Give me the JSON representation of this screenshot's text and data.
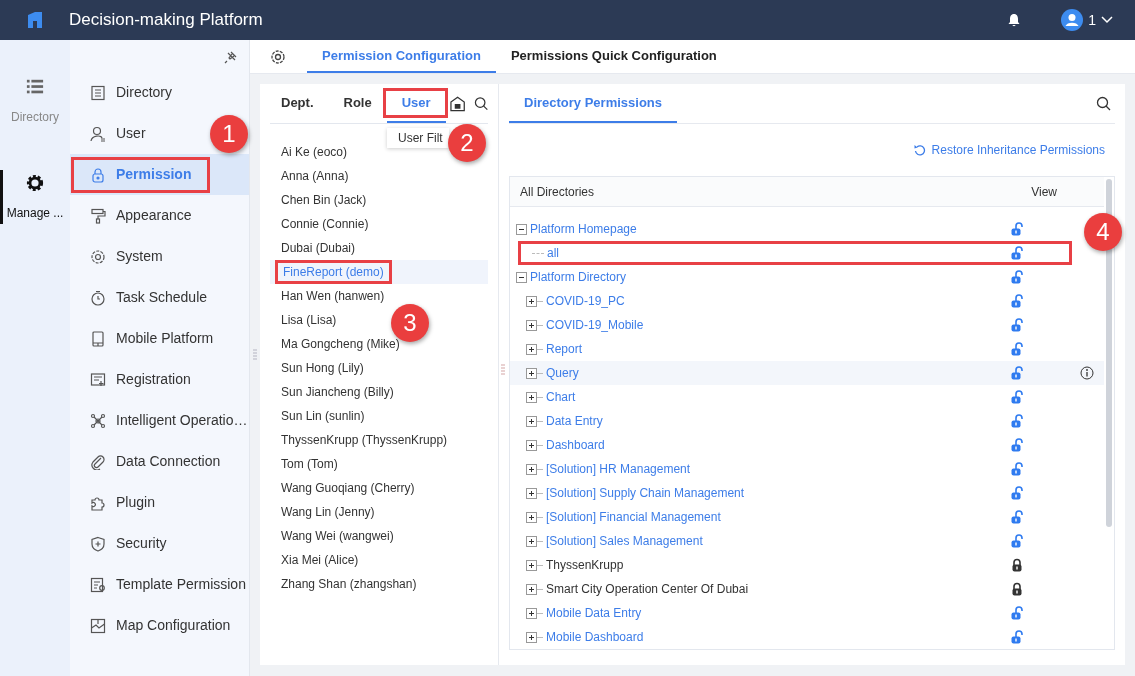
{
  "header": {
    "title": "Decision-making Platform",
    "user": "1"
  },
  "rail": [
    {
      "label": "Directory",
      "kind": "list",
      "selected": false
    },
    {
      "label": "Manage ...",
      "kind": "gear",
      "selected": true
    }
  ],
  "menu": [
    {
      "label": "Directory",
      "kind": "directory",
      "selected": false,
      "highlighted": false
    },
    {
      "label": "User",
      "kind": "user",
      "selected": false,
      "highlighted": false
    },
    {
      "label": "Permission",
      "kind": "lock",
      "selected": true,
      "highlighted": true
    },
    {
      "label": "Appearance",
      "kind": "roller",
      "selected": false,
      "highlighted": false
    },
    {
      "label": "System",
      "kind": "gear",
      "selected": false,
      "highlighted": false
    },
    {
      "label": "Task Schedule",
      "kind": "timer",
      "selected": false,
      "highlighted": false
    },
    {
      "label": "Mobile Platform",
      "kind": "phone",
      "selected": false,
      "highlighted": false
    },
    {
      "label": "Registration",
      "kind": "form",
      "selected": false,
      "highlighted": false
    },
    {
      "label": "Intelligent Operatio…",
      "kind": "network",
      "selected": false,
      "highlighted": false
    },
    {
      "label": "Data Connection",
      "kind": "clip",
      "selected": false,
      "highlighted": false
    },
    {
      "label": "Plugin",
      "kind": "puzzle",
      "selected": false,
      "highlighted": false
    },
    {
      "label": "Security",
      "kind": "shield",
      "selected": false,
      "highlighted": false
    },
    {
      "label": "Template Permission",
      "kind": "doc",
      "selected": false,
      "highlighted": false
    },
    {
      "label": "Map Configuration",
      "kind": "map",
      "selected": false,
      "highlighted": false
    }
  ],
  "top_tabs": [
    {
      "label": "Permission Configuration",
      "selected": true
    },
    {
      "label": "Permissions Quick Configuration",
      "selected": false
    }
  ],
  "user_panel": {
    "tabs": [
      {
        "label": "Dept.",
        "selected": false,
        "highlighted": false
      },
      {
        "label": "Role",
        "selected": false,
        "highlighted": false
      },
      {
        "label": "User",
        "selected": true,
        "highlighted": true
      }
    ],
    "tooltip": "User Filt",
    "users": [
      {
        "name": "Ai Ke (eoco)",
        "selected": false,
        "highlighted": false
      },
      {
        "name": "Anna (Anna)",
        "selected": false,
        "highlighted": false
      },
      {
        "name": "Chen Bin (Jack)",
        "selected": false,
        "highlighted": false
      },
      {
        "name": "Connie (Connie)",
        "selected": false,
        "highlighted": false
      },
      {
        "name": "Dubai (Dubai)",
        "selected": false,
        "highlighted": false
      },
      {
        "name": "FineReport (demo)",
        "selected": true,
        "highlighted": true
      },
      {
        "name": "Han Wen (hanwen)",
        "selected": false,
        "highlighted": false
      },
      {
        "name": "Lisa (Lisa)",
        "selected": false,
        "highlighted": false
      },
      {
        "name": "Ma Gongcheng (Mike)",
        "selected": false,
        "highlighted": false
      },
      {
        "name": "Sun Hong (Lily)",
        "selected": false,
        "highlighted": false
      },
      {
        "name": "Sun Jiancheng (Billy)",
        "selected": false,
        "highlighted": false
      },
      {
        "name": "Sun Lin (sunlin)",
        "selected": false,
        "highlighted": false
      },
      {
        "name": "ThyssenKrupp (ThyssenKrupp)",
        "selected": false,
        "highlighted": false
      },
      {
        "name": "Tom (Tom)",
        "selected": false,
        "highlighted": false
      },
      {
        "name": "Wang Guoqiang (Cherry)",
        "selected": false,
        "highlighted": false
      },
      {
        "name": "Wang Lin (Jenny)",
        "selected": false,
        "highlighted": false
      },
      {
        "name": "Wang Wei (wangwei)",
        "selected": false,
        "highlighted": false
      },
      {
        "name": "Xia Mei (Alice)",
        "selected": false,
        "highlighted": false
      },
      {
        "name": "Zhang Shan (zhangshan)",
        "selected": false,
        "highlighted": false
      }
    ]
  },
  "perm_panel": {
    "tab": "Directory Permissions",
    "restore": "Restore Inheritance Permissions",
    "columns": [
      "All Directories",
      "View"
    ],
    "tree": [
      {
        "name": "Platform Homepage",
        "expanded": true,
        "locked": false,
        "hovered": false,
        "highlighted": false,
        "children": [
          {
            "name": "all",
            "locked": false,
            "hovered": false,
            "highlighted": true
          }
        ]
      },
      {
        "name": "Platform Directory",
        "expanded": true,
        "locked": false,
        "hovered": false,
        "highlighted": false,
        "children": [
          {
            "name": "COVID-19_PC",
            "expanded": false,
            "locked": false,
            "hovered": false,
            "highlighted": false
          },
          {
            "name": "COVID-19_Mobile",
            "expanded": false,
            "locked": false,
            "hovered": false,
            "highlighted": false
          },
          {
            "name": "Report",
            "expanded": false,
            "locked": false,
            "hovered": false,
            "highlighted": false
          },
          {
            "name": "Query",
            "expanded": false,
            "locked": false,
            "hovered": true,
            "highlighted": false
          },
          {
            "name": "Chart",
            "expanded": false,
            "locked": false,
            "hovered": false,
            "highlighted": false
          },
          {
            "name": "Data Entry",
            "expanded": false,
            "locked": false,
            "hovered": false,
            "highlighted": false
          },
          {
            "name": "Dashboard",
            "expanded": false,
            "locked": false,
            "hovered": false,
            "highlighted": false
          },
          {
            "name": "[Solution] HR Management",
            "expanded": false,
            "locked": false,
            "hovered": false,
            "highlighted": false
          },
          {
            "name": "[Solution] Supply Chain Management",
            "expanded": false,
            "locked": false,
            "hovered": false,
            "highlighted": false
          },
          {
            "name": "[Solution] Financial Management",
            "expanded": false,
            "locked": false,
            "hovered": false,
            "highlighted": false
          },
          {
            "name": "[Solution] Sales Management",
            "expanded": false,
            "locked": false,
            "hovered": false,
            "highlighted": false
          },
          {
            "name": "ThyssenKrupp",
            "expanded": false,
            "locked": true,
            "hovered": false,
            "highlighted": false
          },
          {
            "name": "Smart City Operation Center Of Dubai",
            "expanded": false,
            "locked": true,
            "hovered": false,
            "highlighted": false
          },
          {
            "name": "Mobile Data Entry",
            "expanded": false,
            "locked": false,
            "hovered": false,
            "highlighted": false
          },
          {
            "name": "Mobile Dashboard",
            "expanded": false,
            "locked": false,
            "hovered": false,
            "highlighted": false
          }
        ]
      }
    ]
  },
  "callouts": [
    {
      "label": "1"
    },
    {
      "label": "2"
    },
    {
      "label": "3"
    },
    {
      "label": "4"
    }
  ]
}
